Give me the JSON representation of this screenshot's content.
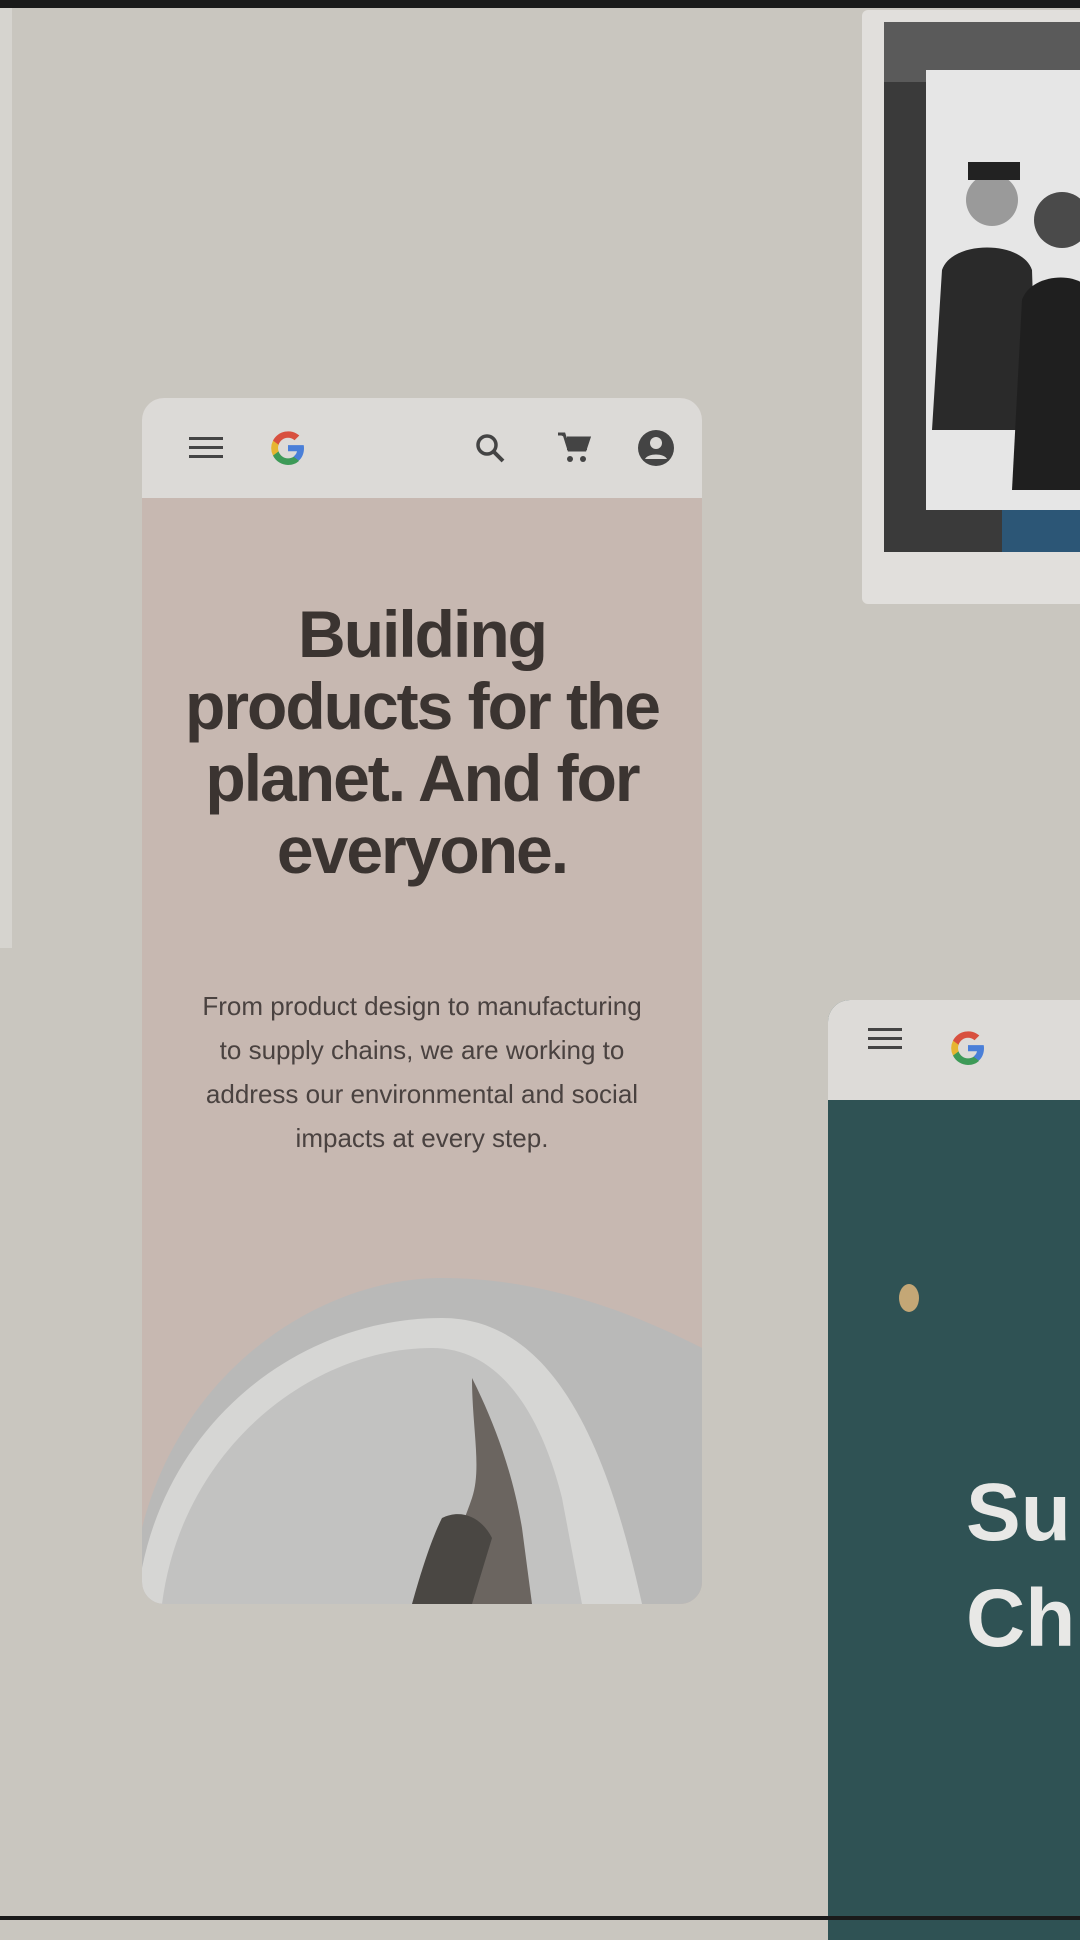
{
  "main_phone": {
    "headline": "Building products for the planet. And for everyone.",
    "subtext": "From product design to manufacturing to supply chains, we are working to address our environmental and social impacts at every step.",
    "icons": [
      "menu-icon",
      "google-logo",
      "search-icon",
      "cart-icon",
      "account-icon"
    ]
  },
  "second_phone": {
    "title_line1": "Su",
    "title_line2": "Ch",
    "icons": [
      "menu-icon",
      "google-logo"
    ]
  },
  "colors": {
    "background": "#c9c6bf",
    "hero": "#c7b8b1",
    "headline": "#3b3431",
    "teal": "#2f5254"
  }
}
